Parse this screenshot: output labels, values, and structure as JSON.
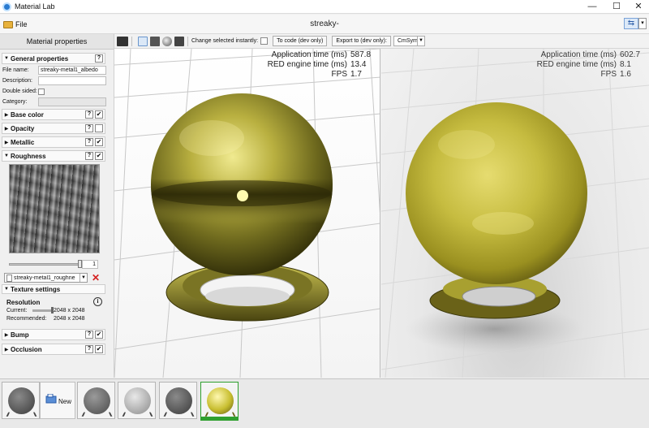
{
  "window": {
    "title": "Material Lab",
    "minimize": "—",
    "maximize": "☐",
    "close": "✕"
  },
  "menubar": {
    "file_label": "File",
    "document_title": "streaky-"
  },
  "left_panel": {
    "header": "Material properties",
    "general": {
      "label": "General properties",
      "help": "?",
      "file_name_label": "File name:",
      "file_name_value": "streaky-metal1_albedo",
      "description_label": "Description:",
      "description_value": "",
      "double_sided_label": "Double sided:",
      "category_label": "Category:"
    },
    "sections": {
      "base_color": "Base color",
      "opacity": "Opacity",
      "metallic": "Metallic",
      "roughness": "Roughness",
      "bump": "Bump",
      "occlusion": "Occlusion"
    },
    "roughness": {
      "slider_value": "1",
      "slider_fraction": 1.0,
      "texture_name": "streaky-metal1_roughne",
      "texture_settings_label": "Texture settings",
      "resolution_title": "Resolution",
      "current_label": "Current:",
      "current_value": "2048 x 2048",
      "recommended_label": "Recommended:",
      "recommended_value": "2048 x 2048"
    }
  },
  "toolbar": {
    "change_instantly_label": "Change selected instantly:",
    "to_code_label": "To code (dev only)",
    "export_label": "Export to (dev only):",
    "export_target": "CmSym"
  },
  "viewports": {
    "left": {
      "app_time_label": "Application time (ms)",
      "app_time_value": "587.8",
      "engine_time_label": "RED engine time (ms)",
      "engine_time_value": "13.4",
      "fps_label": "FPS",
      "fps_value": "1.7"
    },
    "right": {
      "app_time_label": "Application time (ms)",
      "app_time_value": "602.7",
      "engine_time_label": "RED engine time (ms)",
      "engine_time_value": "8.1",
      "fps_label": "FPS",
      "fps_value": "1.6"
    }
  },
  "bottom_strip": {
    "new_label": "New"
  },
  "colors": {
    "gold_light": "#d8d060",
    "gold_mid": "#a8a030",
    "gold_dark": "#4a4510",
    "selection_green": "#2fa02f",
    "accent_blue": "#2a7bd0"
  }
}
